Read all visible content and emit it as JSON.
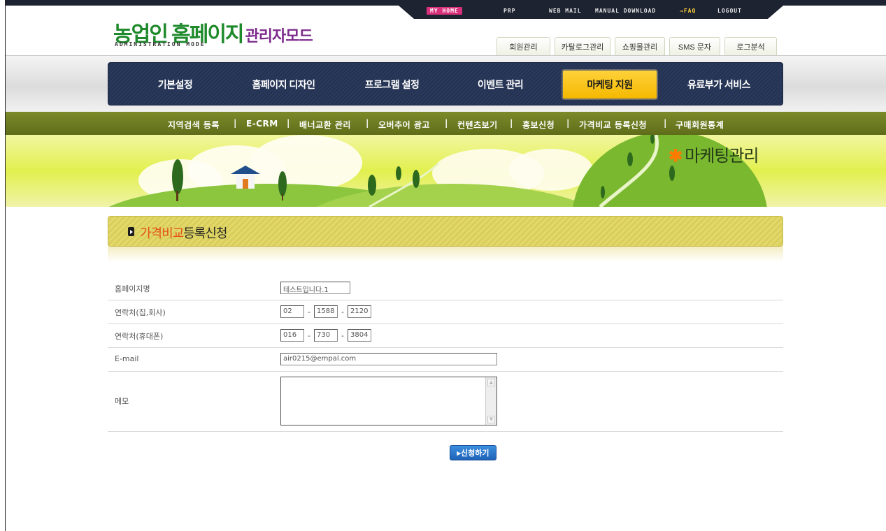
{
  "util_nav": {
    "my_home": "MY HOME",
    "prp": "PRP",
    "web_mail": "WEB MAIL",
    "manual_download": "MANUAL DOWNLOAD",
    "faq": "→FAQ",
    "logout": "LOGOUT"
  },
  "logo": {
    "main": "농업인 홈페이지",
    "sub": "관리자모드",
    "en": "ADMINISTRATION MODE"
  },
  "admin_tabs": [
    "회원관리",
    "카탈로그관리",
    "쇼핑몰관리",
    "SMS 문자",
    "로그분석"
  ],
  "main_nav": {
    "items": [
      "기본설정",
      "홈페이지 디자인",
      "프로그램 설정",
      "이벤트 관리",
      "마케팅 지원",
      "유료부가 서비스"
    ],
    "active": "마케팅 지원"
  },
  "sub_nav": [
    "지역검색 등록",
    "E-CRM",
    "배너교환 관리",
    "오버추어 광고",
    "컨텐츠보기",
    "홍보신청",
    "가격비교 등록신청",
    "구매회원통계"
  ],
  "banner": {
    "title": "마케팅관리"
  },
  "page_title": {
    "highlight": "가격비교",
    "rest": "등록신청"
  },
  "form": {
    "homepage_label": "홈페이지명",
    "homepage_value": "테스트입니다.1",
    "phone_label": "연락처(집,회사)",
    "phone": [
      "02",
      "1588",
      "2120"
    ],
    "mobile_label": "연락처(휴대폰)",
    "mobile": [
      "016",
      "730",
      "3804"
    ],
    "email_label": "E-mail",
    "email_value": "air0215@empal.com",
    "memo_label": "메모",
    "memo_value": "",
    "dash": "-"
  },
  "submit_label": "▸신청하기"
}
